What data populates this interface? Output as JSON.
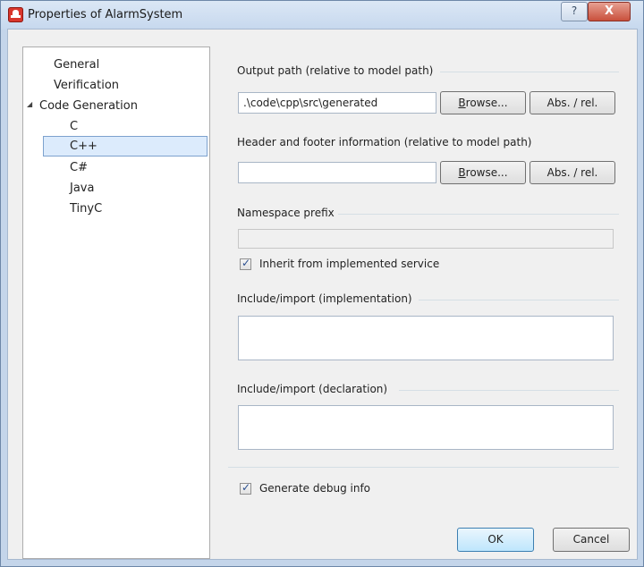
{
  "window": {
    "title": "Properties of AlarmSystem"
  },
  "titlebar": {
    "help_label": "?",
    "close_label": "X"
  },
  "nav": {
    "items": [
      {
        "label": "General"
      },
      {
        "label": "Verification"
      },
      {
        "label": "Code Generation"
      },
      {
        "label": "C"
      },
      {
        "label": "C++"
      },
      {
        "label": "C#"
      },
      {
        "label": "Java"
      },
      {
        "label": "TinyC"
      }
    ],
    "selected": "C++"
  },
  "output_path": {
    "label": "Output path (relative to model path)",
    "value": ".\\code\\cpp\\src\\generated",
    "browse_label": "Browse...",
    "absrel_label": "Abs. / rel."
  },
  "header_footer": {
    "label": "Header and footer information (relative to model path)",
    "value": "",
    "browse_label": "Browse...",
    "absrel_label": "Abs. / rel."
  },
  "namespace": {
    "label": "Namespace prefix",
    "value": "",
    "inherit_label": "Inherit from implemented service",
    "inherit_checked": true
  },
  "include_impl": {
    "label": "Include/import (implementation)",
    "value": ""
  },
  "include_decl": {
    "label": "Include/import (declaration)",
    "value": ""
  },
  "debug": {
    "label": "Generate debug info",
    "checked": true
  },
  "footer": {
    "ok_label": "OK",
    "cancel_label": "Cancel"
  }
}
